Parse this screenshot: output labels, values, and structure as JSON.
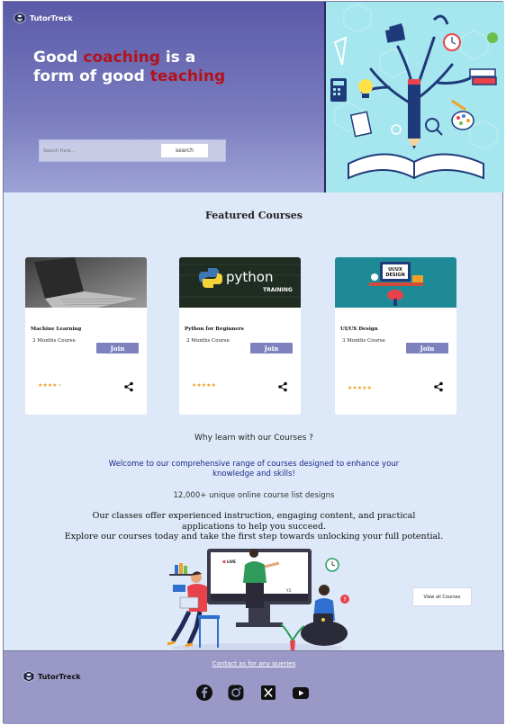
{
  "brand": {
    "name": "TutorTreck"
  },
  "hero": {
    "headline_parts": [
      "Good ",
      "coaching",
      " is a",
      "form of  good ",
      "teaching"
    ],
    "search": {
      "placeholder": "Search Here...",
      "button_label": "search"
    }
  },
  "featured": {
    "title": "Featured Courses",
    "courses": [
      {
        "title": "Machine Learning",
        "duration": "3 Months Course",
        "join_label": "Join",
        "rating": 4
      },
      {
        "title": "Python for Beginners",
        "duration": "2 Months Course",
        "join_label": "Join",
        "rating": 5,
        "image_text": [
          "python",
          "TRAINING"
        ]
      },
      {
        "title": "UI/UX Design",
        "duration": "3 Months Course",
        "join_label": "Join",
        "rating": 5,
        "image_text": [
          "UI/UX",
          "DESIGN"
        ]
      }
    ]
  },
  "why": {
    "title": "Why learn with our Courses ?",
    "intro": "Welcome to our comprehensive range of courses designed to enhance your knowledge and skills!",
    "stat": "12,000+ unique online course list designs",
    "body": [
      "Our classes offer experienced instruction, engaging content, and practical",
      "applications to help you succeed.",
      "Explore our courses today and take the first step towards unlocking your full potential."
    ],
    "view_all_label": "View all Courses",
    "illustration_text": {
      "screen_tag": "LIVE",
      "counter": "Y3"
    }
  },
  "footer": {
    "contact_label": "Contact as for any queries",
    "social": [
      "facebook-icon",
      "instagram-icon",
      "x-icon",
      "youtube-icon"
    ]
  },
  "colors": {
    "accent": "#b3121b",
    "join": "#7d82be",
    "hero_bg": "#5a5aa9",
    "footer_bg": "#9a98c6",
    "intro_text": "#1d2a8a"
  }
}
